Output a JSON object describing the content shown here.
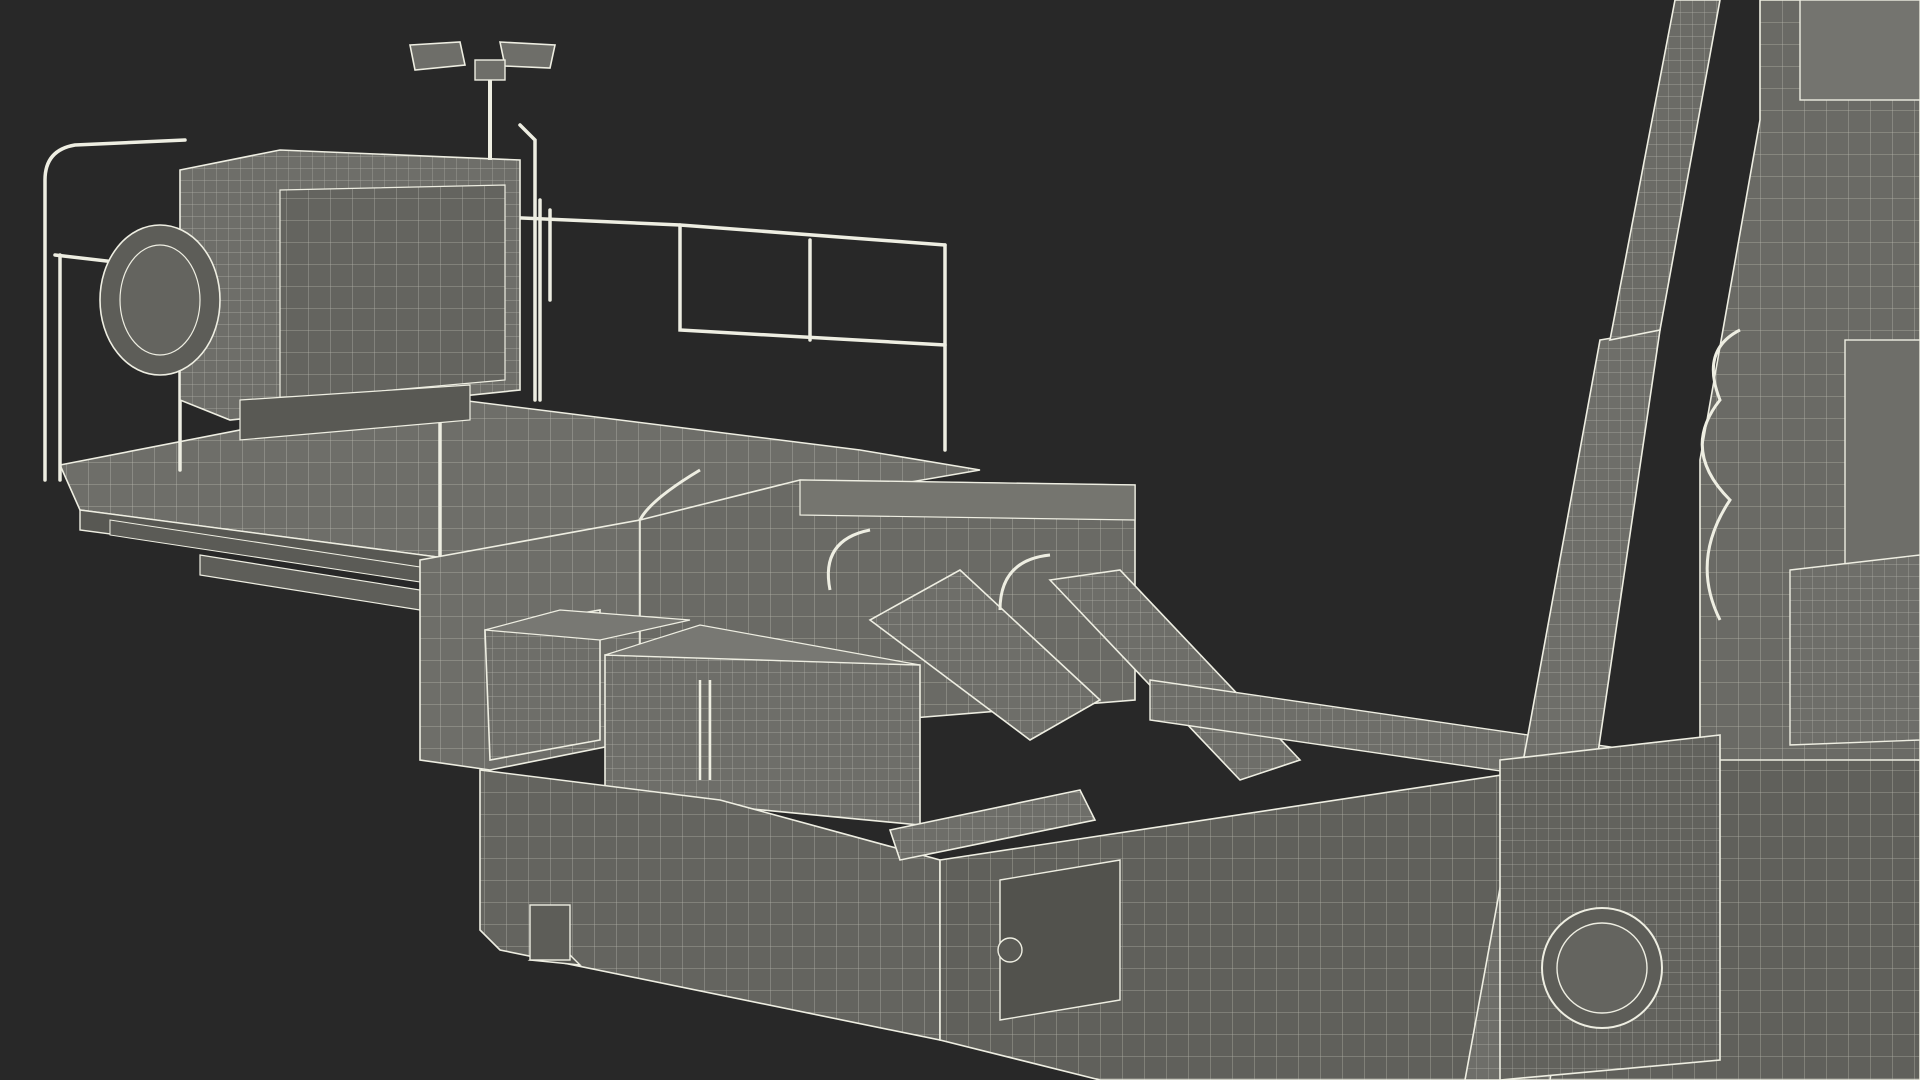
{
  "scene": {
    "background_color": "#282828",
    "mesh_fill_color": "#6e6e69",
    "mesh_fill_shadow_color": "#585853",
    "wire_color": "#eeeee2",
    "description_hidden": ""
  }
}
